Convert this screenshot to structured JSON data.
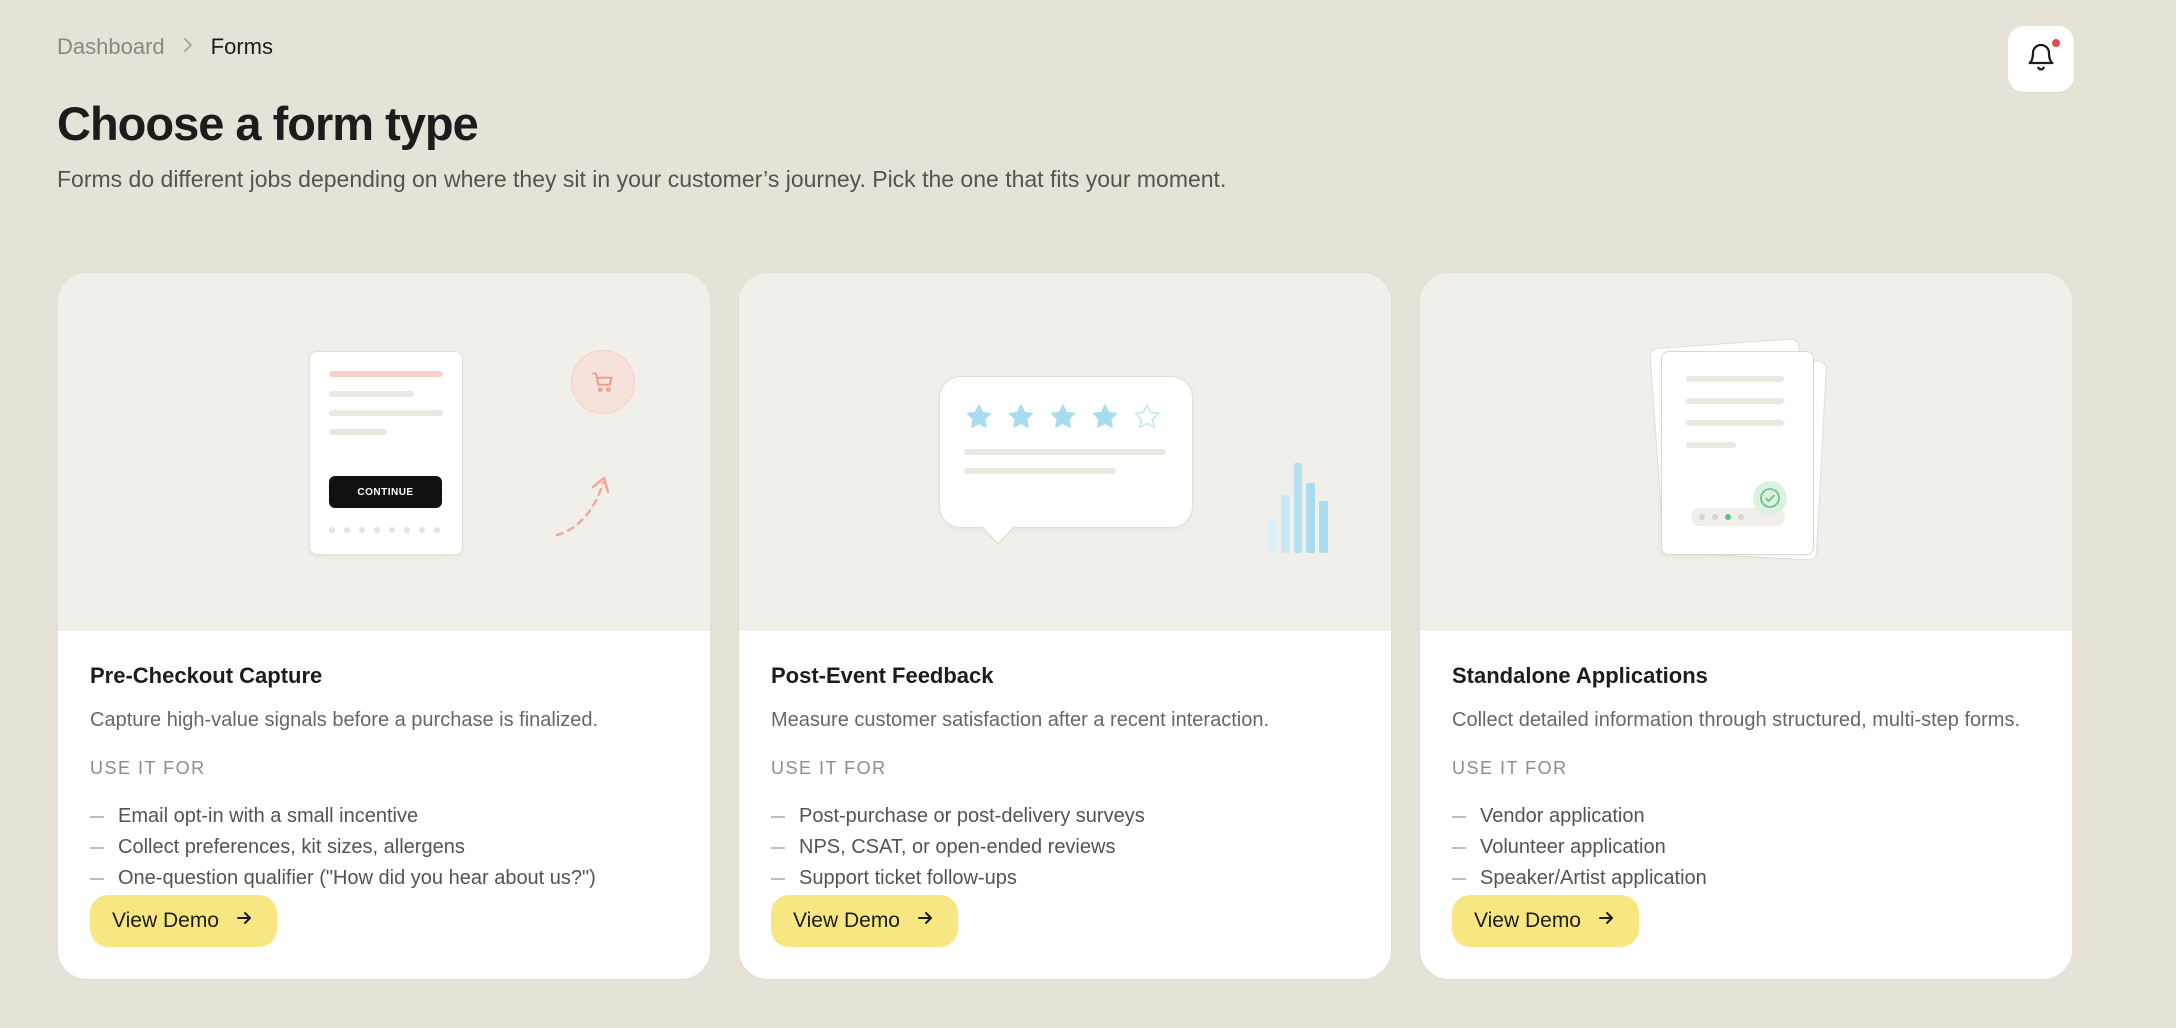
{
  "breadcrumb": {
    "parent": "Dashboard",
    "current": "Forms"
  },
  "header": {
    "title": "Choose a form type",
    "subtitle": "Forms do different jobs depending on where they sit in your customer’s journey. Pick the one that fits your moment."
  },
  "cards": [
    {
      "title": "Pre-Checkout Capture",
      "description": "Capture high-value signals before a purchase is finalized.",
      "use_label": "USE IT FOR",
      "uses": [
        "Email opt-in with a small incentive",
        "Collect preferences, kit sizes, allergens",
        "One-question qualifier (\"How did you hear about us?\")"
      ],
      "button": "View Demo",
      "illustration_button": "CONTINUE"
    },
    {
      "title": "Post-Event Feedback",
      "description": "Measure customer satisfaction after a recent interaction.",
      "use_label": "USE IT FOR",
      "uses": [
        "Post-purchase or post-delivery surveys",
        "NPS, CSAT, or open-ended reviews",
        "Support ticket follow-ups"
      ],
      "button": "View Demo",
      "rating_filled": 4,
      "rating_total": 5
    },
    {
      "title": "Standalone Applications",
      "description": "Collect detailed information through structured, multi-step forms.",
      "use_label": "USE IT FOR",
      "uses": [
        "Vendor application",
        "Volunteer application",
        "Speaker/Artist application"
      ],
      "button": "View Demo"
    }
  ],
  "colors": {
    "background": "#e6e2d7",
    "button": "#f7e783",
    "notification_dot": "#e5484d",
    "accent_coral": "#f0a898",
    "accent_blue": "#a8dcef",
    "accent_green": "#5bc47a"
  },
  "icons": {
    "notification": "bell-icon",
    "breadcrumb_separator": "chevron-right-icon",
    "button_arrow": "arrow-right-icon",
    "cart": "cart-icon",
    "check": "check-icon",
    "star": "star-icon"
  }
}
